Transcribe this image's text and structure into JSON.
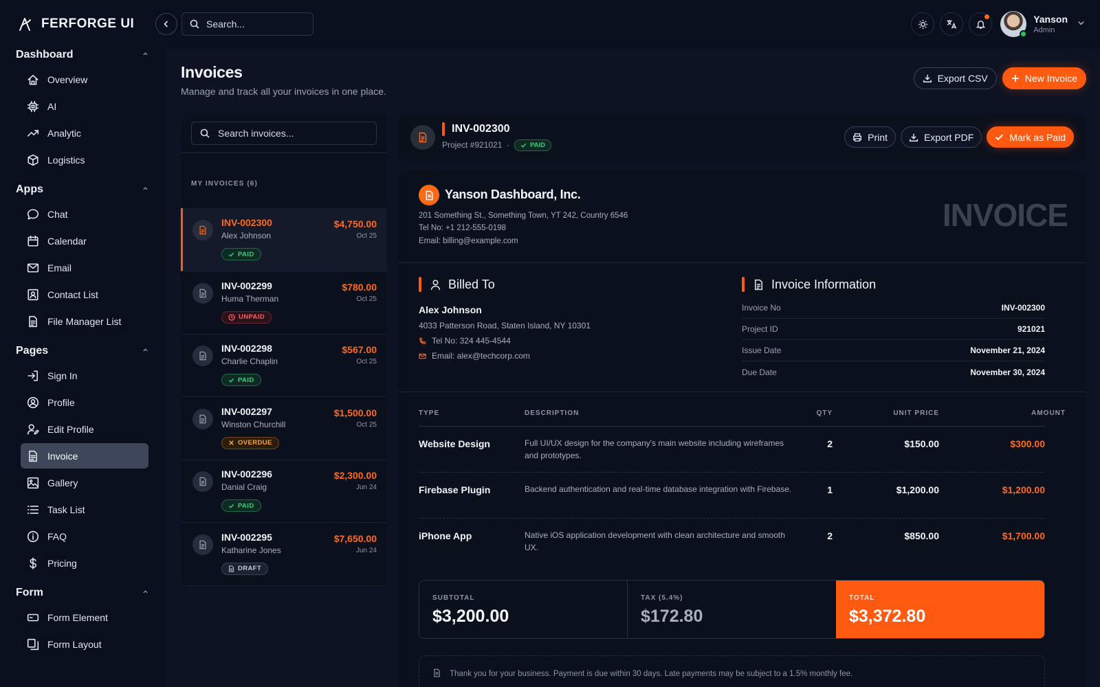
{
  "brand": {
    "name": "FERFORGE UI"
  },
  "topbar": {
    "search_placeholder": "Search...",
    "user": {
      "name": "Yanson",
      "role": "Admin"
    }
  },
  "sidebar": {
    "sections": [
      {
        "title": "Dashboard",
        "items": [
          {
            "label": "Overview",
            "icon": "home-icon"
          },
          {
            "label": "AI",
            "icon": "chip-icon"
          },
          {
            "label": "Analytic",
            "icon": "trend-icon"
          },
          {
            "label": "Logistics",
            "icon": "box-icon"
          }
        ]
      },
      {
        "title": "Apps",
        "items": [
          {
            "label": "Chat",
            "icon": "chat-icon"
          },
          {
            "label": "Calendar",
            "icon": "calendar-icon"
          },
          {
            "label": "Email",
            "icon": "mail-icon"
          },
          {
            "label": "Contact List",
            "icon": "contact-icon"
          },
          {
            "label": "File Manager List",
            "icon": "file-icon"
          }
        ]
      },
      {
        "title": "Pages",
        "items": [
          {
            "label": "Sign In",
            "icon": "signin-icon"
          },
          {
            "label": "Profile",
            "icon": "profile-icon"
          },
          {
            "label": "Edit Profile",
            "icon": "edit-profile-icon"
          },
          {
            "label": "Invoice",
            "icon": "invoice-icon",
            "active": true
          },
          {
            "label": "Gallery",
            "icon": "gallery-icon"
          },
          {
            "label": "Task List",
            "icon": "list-icon"
          },
          {
            "label": "FAQ",
            "icon": "info-icon"
          },
          {
            "label": "Pricing",
            "icon": "dollar-icon"
          }
        ]
      },
      {
        "title": "Form",
        "items": [
          {
            "label": "Form Element",
            "icon": "form-element-icon"
          },
          {
            "label": "Form Layout",
            "icon": "form-layout-icon"
          }
        ]
      }
    ]
  },
  "page": {
    "title": "Invoices",
    "subtitle": "Manage and track all your invoices in one place.",
    "export_csv": "Export CSV",
    "new_invoice": "New Invoice"
  },
  "list": {
    "search_placeholder": "Search invoices...",
    "label": "MY INVOICES (6)",
    "items": [
      {
        "no": "INV-002300",
        "customer": "Alex Johnson",
        "amount": "$4,750.00",
        "date": "Oct 25",
        "status": "PAID",
        "status_type": "paid",
        "active": true
      },
      {
        "no": "INV-002299",
        "customer": "Huma Therman",
        "amount": "$780.00",
        "date": "Oct 25",
        "status": "UNPAID",
        "status_type": "unpaid"
      },
      {
        "no": "INV-002298",
        "customer": "Charlie Chaplin",
        "amount": "$567.00",
        "date": "Oct 25",
        "status": "PAID",
        "status_type": "paid"
      },
      {
        "no": "INV-002297",
        "customer": "Winston Churchill",
        "amount": "$1,500.00",
        "date": "Oct 25",
        "status": "OVERDUE",
        "status_type": "overdue"
      },
      {
        "no": "INV-002296",
        "customer": "Danial Craig",
        "amount": "$2,300.00",
        "date": "Jun 24",
        "status": "PAID",
        "status_type": "paid"
      },
      {
        "no": "INV-002295",
        "customer": "Katharine Jones",
        "amount": "$7,650.00",
        "date": "Jun 24",
        "status": "DRAFT",
        "status_type": "draft"
      }
    ]
  },
  "detail": {
    "invoice_no": "INV-002300",
    "project": "Project #921021",
    "status": "PAID",
    "print": "Print",
    "export_pdf": "Export PDF",
    "mark_paid": "Mark as Paid",
    "company": {
      "name": "Yanson Dashboard, Inc.",
      "address": "201 Something St., Something Town, YT 242, Country 6546",
      "tel": "Tel No: +1 212-555-0198",
      "email": "Email: billing@example.com"
    },
    "watermark": "INVOICE",
    "billed_to": {
      "title": "Billed To",
      "name": "Alex Johnson",
      "address": "4033 Patterson Road, Staten Island, NY 10301",
      "tel": "Tel No: 324 445-4544",
      "email": "Email: alex@techcorp.com"
    },
    "info": {
      "title": "Invoice Information",
      "rows": [
        {
          "k": "Invoice No",
          "v": "INV-002300"
        },
        {
          "k": "Project ID",
          "v": "921021"
        },
        {
          "k": "Issue Date",
          "v": "November 21, 2024"
        },
        {
          "k": "Due Date",
          "v": "November 30, 2024"
        }
      ]
    },
    "table": {
      "headers": {
        "type": "TYPE",
        "desc": "DESCRIPTION",
        "qty": "QTY",
        "price": "UNIT PRICE",
        "amount": "AMOUNT"
      },
      "rows": [
        {
          "type": "Website Design",
          "desc": "Full UI/UX design for the company's main website including wireframes and prototypes.",
          "qty": "2",
          "price": "$150.00",
          "amount": "$300.00"
        },
        {
          "type": "Firebase Plugin",
          "desc": "Backend authentication and real-time database integration with Firebase.",
          "qty": "1",
          "price": "$1,200.00",
          "amount": "$1,200.00"
        },
        {
          "type": "iPhone App",
          "desc": "Native iOS application development with clean architecture and smooth UX.",
          "qty": "2",
          "price": "$850.00",
          "amount": "$1,700.00"
        }
      ]
    },
    "totals": {
      "subtotal_label": "SUBTOTAL",
      "subtotal": "$3,200.00",
      "tax_label": "TAX (5.4%)",
      "tax": "$172.80",
      "total_label": "TOTAL",
      "total": "$3,372.80"
    },
    "note": "Thank you for your business. Payment is due within 30 days. Late payments may be subject to a 1.5% monthly fee."
  },
  "colors": {
    "accent": "#ff5a10",
    "paid": "#35d07f",
    "unpaid": "#ff5a6a",
    "overdue": "#ffa63a",
    "bg": "#0b1020"
  }
}
